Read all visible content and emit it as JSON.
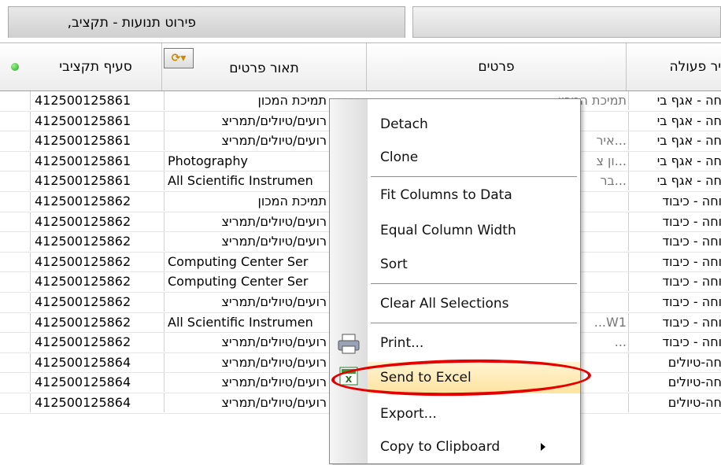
{
  "window": {
    "title": "פירוט תנועות - תקציב,"
  },
  "columns": {
    "budget_section": "סעיף תקציבי",
    "item_description": "תאור פרטים",
    "items": "פרטים",
    "action_type": "יר פעולה"
  },
  "rows": [
    {
      "code": "412500125861",
      "desc": "תמיכת המכון",
      "desc_rtl": true,
      "items": "תמיכת המכון",
      "action": "חה - אגף בי"
    },
    {
      "code": "412500125861",
      "desc": "רועים/טיולים/תמריצ",
      "desc_rtl": true,
      "items": "",
      "action": "חה - אגף בי"
    },
    {
      "code": "412500125861",
      "desc": "רועים/טיולים/תמריצ",
      "desc_rtl": true,
      "items": "...איר",
      "action": "חה - אגף בי"
    },
    {
      "code": "412500125861",
      "desc": "Photography",
      "desc_rtl": false,
      "items": "...ון צ",
      "action": "חה - אגף בי"
    },
    {
      "code": "412500125861",
      "desc": "All Scientific Instrumen",
      "desc_rtl": false,
      "items": "...בר",
      "action": "חה - אגף בי"
    },
    {
      "code": "412500125862",
      "desc": "תמיכת המכון",
      "desc_rtl": true,
      "items": "",
      "action": "וחה - כיבוד"
    },
    {
      "code": "412500125862",
      "desc": "רועים/טיולים/תמריצ",
      "desc_rtl": true,
      "items": "",
      "action": "וחה - כיבוד"
    },
    {
      "code": "412500125862",
      "desc": "רועים/טיולים/תמריצ",
      "desc_rtl": true,
      "items": "",
      "action": "וחה - כיבוד"
    },
    {
      "code": "412500125862",
      "desc": "Computing Center Ser",
      "desc_rtl": false,
      "items": "",
      "action": "וחה - כיבוד"
    },
    {
      "code": "412500125862",
      "desc": "Computing Center Ser",
      "desc_rtl": false,
      "items": "",
      "action": "וחה - כיבוד"
    },
    {
      "code": "412500125862",
      "desc": "רועים/טיולים/תמריצ",
      "desc_rtl": true,
      "items": "",
      "action": "וחה - כיבוד"
    },
    {
      "code": "412500125862",
      "desc": "All Scientific Instrumen",
      "desc_rtl": false,
      "items": "W1...",
      "action": "וחה - כיבוד"
    },
    {
      "code": "412500125862",
      "desc": "רועים/טיולים/תמריצ",
      "desc_rtl": true,
      "items": "...",
      "action": "וחה - כיבוד"
    },
    {
      "code": "412500125864",
      "desc": "רועים/טיולים/תמריצ",
      "desc_rtl": true,
      "items": "",
      "action": "חה-טיולים"
    },
    {
      "code": "412500125864",
      "desc": "רועים/טיולים/תמריצ",
      "desc_rtl": true,
      "items": "",
      "action": "חה-טיולים"
    },
    {
      "code": "412500125864",
      "desc": "רועים/טיולים/תמריצ",
      "desc_rtl": true,
      "items": "",
      "action": "חה-טיולים"
    }
  ],
  "context_menu": {
    "detach": "Detach",
    "clone": "Clone",
    "fit_columns": "Fit Columns to Data",
    "equal_width": "Equal Column Width",
    "sort": "Sort",
    "clear_selections": "Clear All Selections",
    "print": "Print...",
    "send_excel": "Send to Excel",
    "export": "Export...",
    "copy_clipboard": "Copy to Clipboard"
  },
  "colors": {
    "highlight_ring": "#e40000",
    "menu_highlight": "#ffe3a0",
    "status_dot": "#1ea31e"
  },
  "icons": {
    "header_action": "refresh-dropdown-icon",
    "print": "printer-icon",
    "excel": "excel-icon"
  }
}
